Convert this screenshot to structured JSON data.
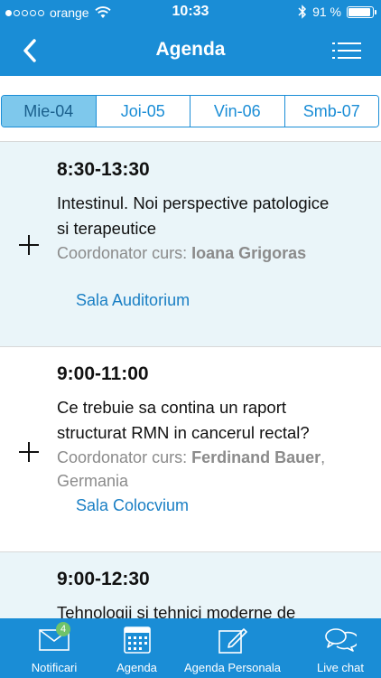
{
  "status_bar": {
    "carrier": "orange",
    "signal_bars_filled": 1,
    "signal_bars_total": 5,
    "time": "10:33",
    "battery_text": "91 %",
    "battery_level": 0.91
  },
  "nav": {
    "title": "Agenda",
    "back_icon": "back-chevron-icon",
    "menu_icon": "list-menu-icon"
  },
  "days": [
    {
      "label": "Mie-04",
      "active": true
    },
    {
      "label": "Joi-05",
      "active": false
    },
    {
      "label": "Vin-06",
      "active": false
    },
    {
      "label": "Smb-07",
      "active": false
    }
  ],
  "sessions": [
    {
      "time": "8:30-13:30",
      "topic_lines": [
        "Intestinul. Noi perspective patologice",
        "si terapeutice"
      ],
      "coordinator_label": "Coordonator curs:",
      "coordinator_name": "Ioana Grigoras",
      "coordinator_suffix": "",
      "coordinator_extra": "",
      "room": "Sala Auditorium"
    },
    {
      "time": "9:00-11:00",
      "topic_lines": [
        "Ce trebuie sa contina un raport",
        "structurat RMN in cancerul rectal?"
      ],
      "coordinator_label": "Coordonator curs:",
      "coordinator_name": "Ferdinand Bauer",
      "coordinator_suffix": ",",
      "coordinator_extra": "Germania",
      "room": "Sala Colocvium"
    },
    {
      "time": "9:00-12:30",
      "topic_lines": [
        "Tehnologii si tehnici moderne de"
      ],
      "coordinator_label": "",
      "coordinator_name": "",
      "coordinator_suffix": "",
      "coordinator_extra": "",
      "room": ""
    }
  ],
  "tabs": [
    {
      "label": "Notificari",
      "icon": "envelope-icon",
      "badge": "4"
    },
    {
      "label": "Agenda",
      "icon": "calendar-icon"
    },
    {
      "label": "Agenda Personala",
      "icon": "edit-note-icon"
    },
    {
      "label": "Live chat",
      "icon": "chat-bubbles-icon"
    }
  ],
  "colors": {
    "primary": "#1a8dd6",
    "active_segment": "#7ec8ec",
    "tinted_row": "#eaf5f9",
    "room_link": "#1a7fc4",
    "badge": "#6fc36a"
  }
}
